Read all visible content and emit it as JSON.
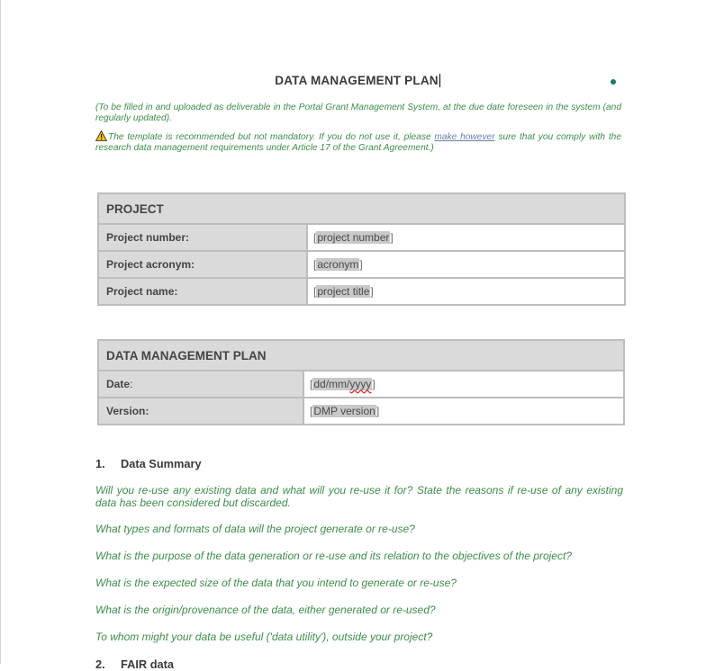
{
  "document": {
    "title": "DATA MANAGEMENT PLAN",
    "intro_note": "(To be filled in and uploaded as deliverable in the Portal Grant Management System, at the due date foreseen in the system (and regularly updated).",
    "template_note_before": "The template is recommended but not mandatory. If you do not use it, please ",
    "template_note_link": "make however",
    "template_note_after": " sure that you comply with the research data management requirements under Article 17 of the Grant Agreement.)",
    "warning_icon": "warning-triangle-icon",
    "accent_color": "#3f8d4b"
  },
  "project_table": {
    "header": "PROJECT",
    "rows": [
      {
        "label": "Project number:",
        "placeholder": "project number"
      },
      {
        "label": "Project acronym:",
        "placeholder": "acronym"
      },
      {
        "label": "Project name:",
        "placeholder": "project title"
      }
    ]
  },
  "dmp_table": {
    "header": "DATA MANAGEMENT PLAN",
    "rows": [
      {
        "label": "Date",
        "suffix": ":",
        "placeholder_a": "dd/mm/",
        "placeholder_b": "yyyy"
      },
      {
        "label": "Version:",
        "placeholder": "DMP version"
      }
    ]
  },
  "brackets": {
    "open": "[",
    "close": "]"
  },
  "section1": {
    "number": "1.",
    "title": "Data Summary",
    "questions": [
      "Will you re-use any existing data and what will you re-use it for? State the reasons if re-use of any existing data has been considered but discarded.",
      "What types and formats of data will the project generate or re-use?",
      "What is the purpose of the data generation or re-use and its relation to the objectives of the project?",
      "What is the expected size of the data that you intend to generate or re-use?",
      "What is the origin/provenance of the data, either generated or re-used?",
      "To whom might your data be useful ('data utility'), outside your project?"
    ]
  },
  "section2": {
    "number": "2.",
    "title": "FAIR data"
  }
}
